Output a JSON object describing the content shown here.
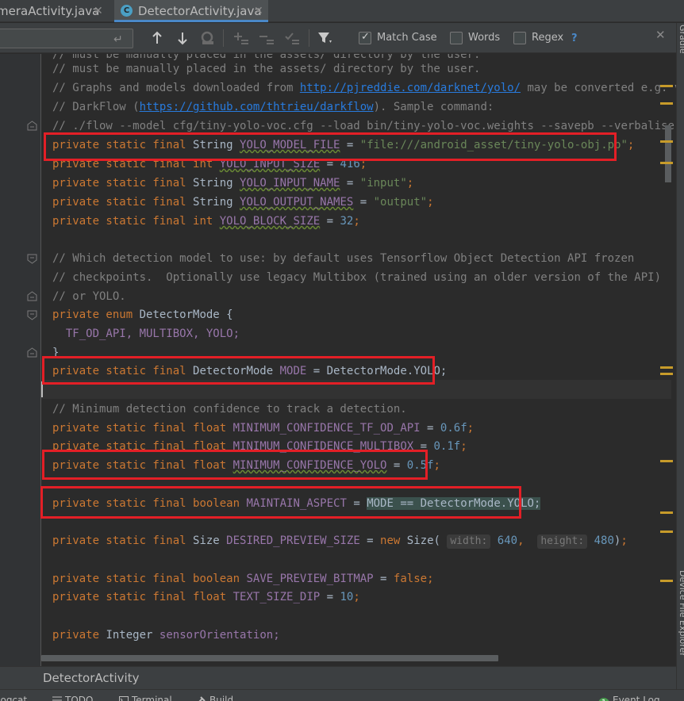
{
  "tabs": [
    {
      "label": "meraActivity.java",
      "close": "✕",
      "active": false
    },
    {
      "label": "DetectorActivity.java",
      "close": "✕",
      "active": true,
      "icon": "C"
    }
  ],
  "find": {
    "enter_glyph": "↵",
    "up_icon": "arrow-up-icon",
    "down_icon": "arrow-down-icon",
    "match_case": {
      "label": "Match Case",
      "checked": true
    },
    "words": {
      "label": "Words",
      "checked": false
    },
    "regex": {
      "label": "Regex",
      "checked": false
    },
    "help": "?",
    "close": "✕"
  },
  "code": {
    "comment_top_1": "// must be manually placed in the assets/ directory by the user.",
    "comment_top_2a": "// Graphs and models downloaded from ",
    "comment_top_2_url": "http://pjreddie.com/darknet/yolo/",
    "comment_top_2b": " may be converted e.g. via",
    "comment_top_3a": "// DarkFlow (",
    "comment_top_3_url": "https://github.com/thtrieu/darkflow",
    "comment_top_3b": "). Sample command:",
    "comment_top_4": "// ./flow --model cfg/tiny-yolo-voc.cfg --load bin/tiny-yolo-voc.weights --savepb --verbalise",
    "kw_psf": "private static final",
    "t_string": "String",
    "t_int": "int",
    "t_float": "float",
    "t_boolean": "boolean",
    "t_size": "Size",
    "t_mode": "DetectorMode",
    "yolo_model_file": "YOLO_MODEL_FILE",
    "yolo_model_file_val": "\"file:///android_asset/tiny-yolo-obj.pb\"",
    "yolo_input_size": "YOLO_INPUT_SIZE",
    "yolo_input_size_val": "416",
    "yolo_input_name": "YOLO_INPUT_NAME",
    "yolo_input_name_val": "\"input\"",
    "yolo_output_names": "YOLO_OUTPUT_NAMES",
    "yolo_output_names_val": "\"output\"",
    "yolo_block_size": "YOLO_BLOCK_SIZE",
    "yolo_block_size_val": "32",
    "c_which_1": "// Which detection model to use: by default uses Tensorflow Object Detection API frozen",
    "c_which_2": "// checkpoints.  Optionally use legacy Multibox (trained using an older version of the API)",
    "c_which_3": "// or YOLO.",
    "kw_private_enum": "private enum",
    "enum_decl": "DetectorMode {",
    "enum_values": "TF_OD_API, MULTIBOX, YOLO;",
    "enum_close": "}",
    "mode": "MODE",
    "mode_val": "DetectorMode.YOLO;",
    "c_min": "// Minimum detection confidence to track a detection.",
    "min_tf": "MINIMUM_CONFIDENCE_TF_OD_API",
    "min_tf_val": "0.6f",
    "min_mb": "MINIMUM_CONFIDENCE_MULTIBOX",
    "min_mb_val": "0.1f",
    "min_yolo": "MINIMUM_CONFIDENCE_YOLO",
    "min_yolo_val": "0.5f",
    "maintain": "MAINTAIN_ASPECT",
    "maintain_val": "MODE == DetectorMode.YOLO;",
    "preview_size": "DESIRED_PREVIEW_SIZE",
    "kw_new": "new",
    "hint_width": "width:",
    "val_640": "640",
    "hint_height": "height:",
    "val_480": "480",
    "save_bitmap": "SAVE_PREVIEW_BITMAP",
    "kw_false": "false",
    "text_size": "TEXT_SIZE_DIP",
    "val_10": "10",
    "kw_private": "private",
    "t_integer": "Integer",
    "sensor": "sensorOrientation;"
  },
  "breadcrumb": "DetectorActivity",
  "bottom_tools": [
    "Logcat",
    "TODO",
    "Terminal",
    "Build"
  ],
  "event_log": "Event Log",
  "right_tools": [
    "Gradle",
    "Device File Explorer"
  ],
  "colors": {
    "keyword": "#cc7832",
    "comment": "#808080",
    "string": "#6a8759",
    "number": "#6897bb",
    "constant": "#9876aa",
    "highlight_box": "#e31f26"
  }
}
